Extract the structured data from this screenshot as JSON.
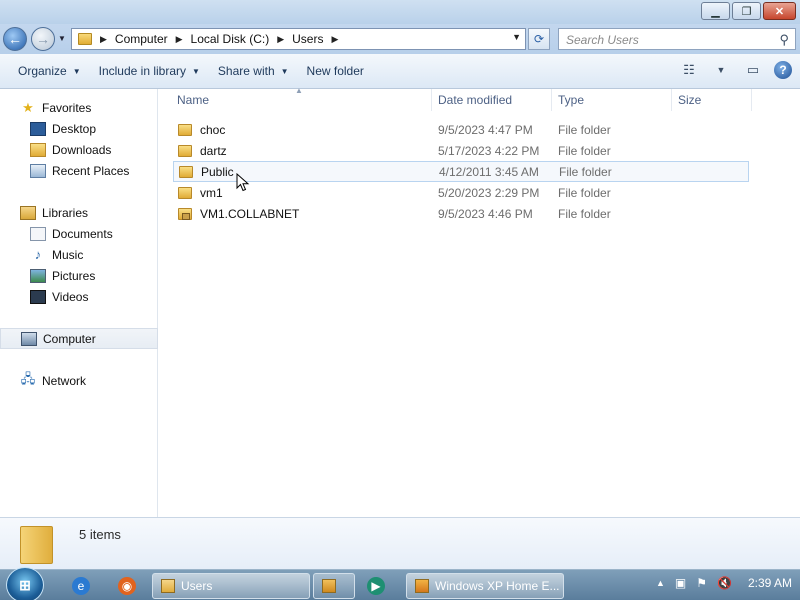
{
  "address": {
    "crumbs": [
      "Computer",
      "Local Disk (C:)",
      "Users"
    ]
  },
  "search": {
    "placeholder": "Search Users"
  },
  "toolbar": {
    "organize": "Organize",
    "include": "Include in library",
    "share": "Share with",
    "new_folder": "New folder"
  },
  "nav": {
    "favorites": "Favorites",
    "desktop": "Desktop",
    "downloads": "Downloads",
    "recent": "Recent Places",
    "libraries": "Libraries",
    "documents": "Documents",
    "music": "Music",
    "pictures": "Pictures",
    "videos": "Videos",
    "computer": "Computer",
    "network": "Network"
  },
  "columns": {
    "name": "Name",
    "date": "Date modified",
    "type": "Type",
    "size": "Size"
  },
  "files": [
    {
      "name": "choc",
      "date": "9/5/2023 4:47 PM",
      "type": "File folder"
    },
    {
      "name": "dartz",
      "date": "5/17/2023 4:22 PM",
      "type": "File folder"
    },
    {
      "name": "Public",
      "date": "4/12/2011 3:45 AM",
      "type": "File folder"
    },
    {
      "name": "vm1",
      "date": "5/20/2023 2:29 PM",
      "type": "File folder"
    },
    {
      "name": "VM1.COLLABNET",
      "date": "9/5/2023 4:46 PM",
      "type": "File folder"
    }
  ],
  "details": {
    "count": "5 items"
  },
  "taskbar": {
    "users_task": "Users",
    "vm_task": "Windows XP Home E...",
    "clock": "2:39 AM"
  }
}
